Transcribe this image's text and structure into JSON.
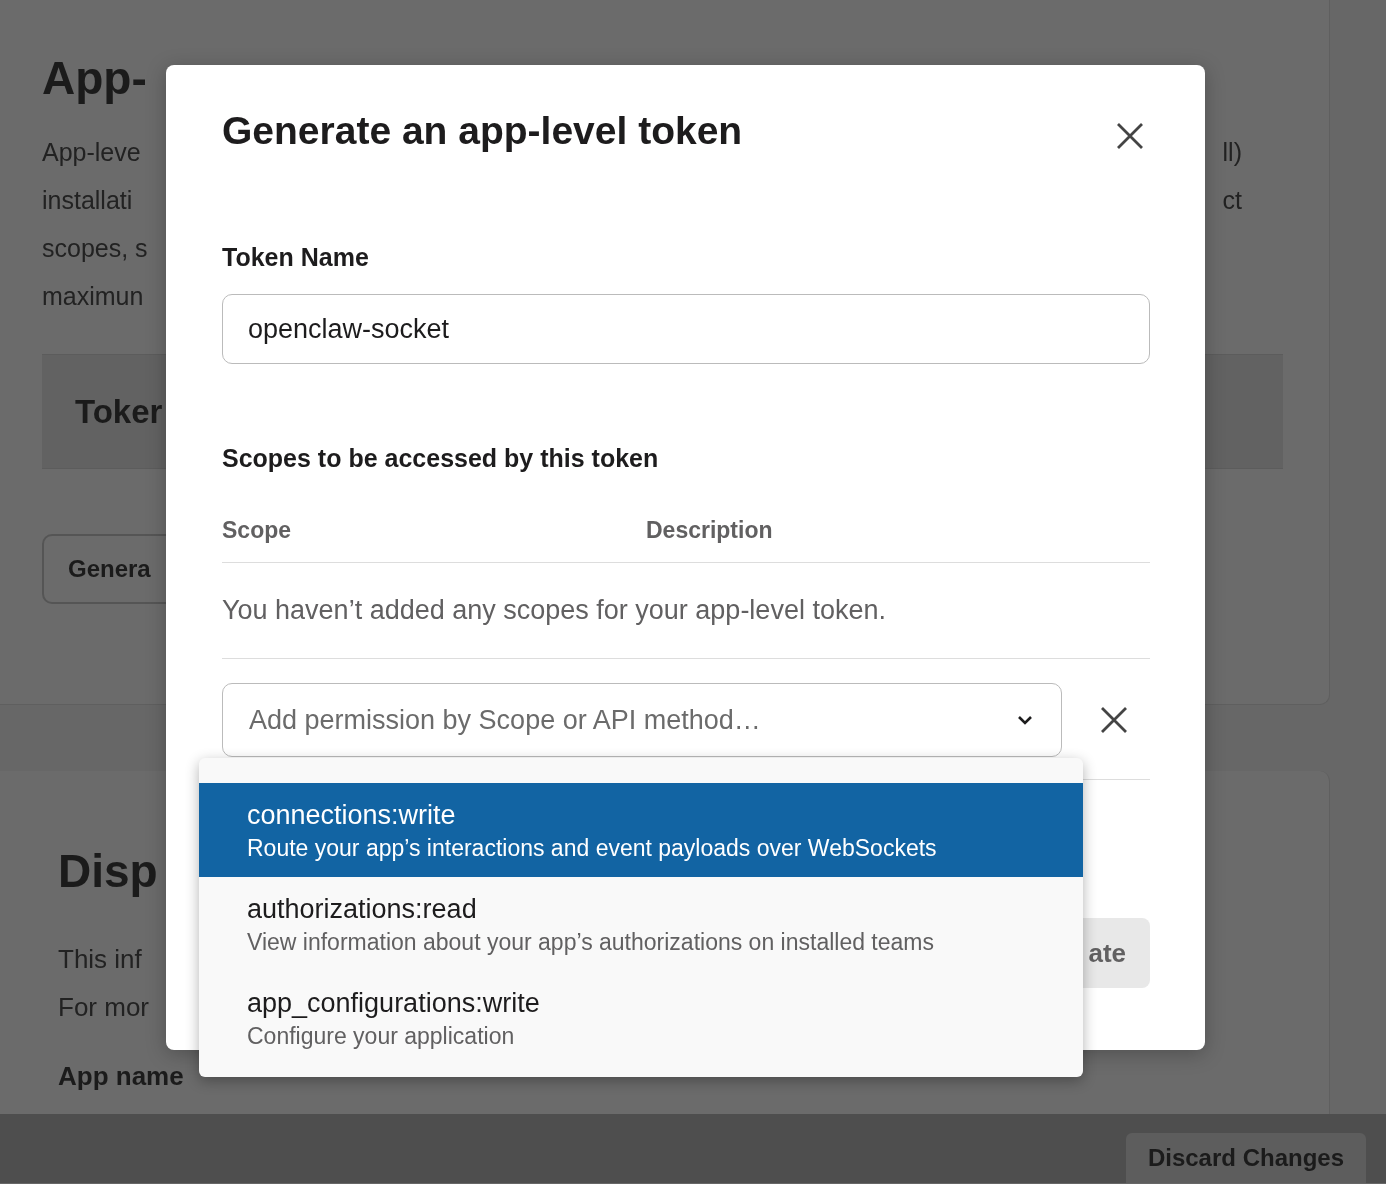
{
  "background": {
    "heading": "App-",
    "paragraph_lines": [
      {
        "left": "App-leve",
        "right": "ll)"
      },
      {
        "left": "installati",
        "right": "ct"
      },
      {
        "left": "scopes, s"
      },
      {
        "left": "maximun"
      }
    ],
    "section_title": "Toker",
    "generate_button": "Genera",
    "display_heading": "Disp",
    "display_lines": [
      "This inf",
      "For mor"
    ],
    "app_name_label": "App name",
    "discard_button": "Discard Changes"
  },
  "modal": {
    "title": "Generate an app-level token",
    "token_name": {
      "label": "Token Name",
      "value": "openclaw-socket"
    },
    "scopes": {
      "heading": "Scopes to be accessed by this token",
      "columns": [
        "Scope",
        "Description"
      ],
      "empty_message": "You haven’t added any scopes for your app-level token.",
      "select": {
        "placeholder": "Add permission by Scope or API method…",
        "expanded": true
      },
      "options": [
        {
          "name": "connections:write",
          "description": "Route your app’s interactions and event payloads over WebSockets",
          "selected": true
        },
        {
          "name": "authorizations:read",
          "description": "View information about your app’s authorizations on installed teams",
          "selected": false
        },
        {
          "name": "app_configurations:write",
          "description": "Configure your application",
          "selected": false
        }
      ]
    },
    "generate_button": "ate"
  }
}
